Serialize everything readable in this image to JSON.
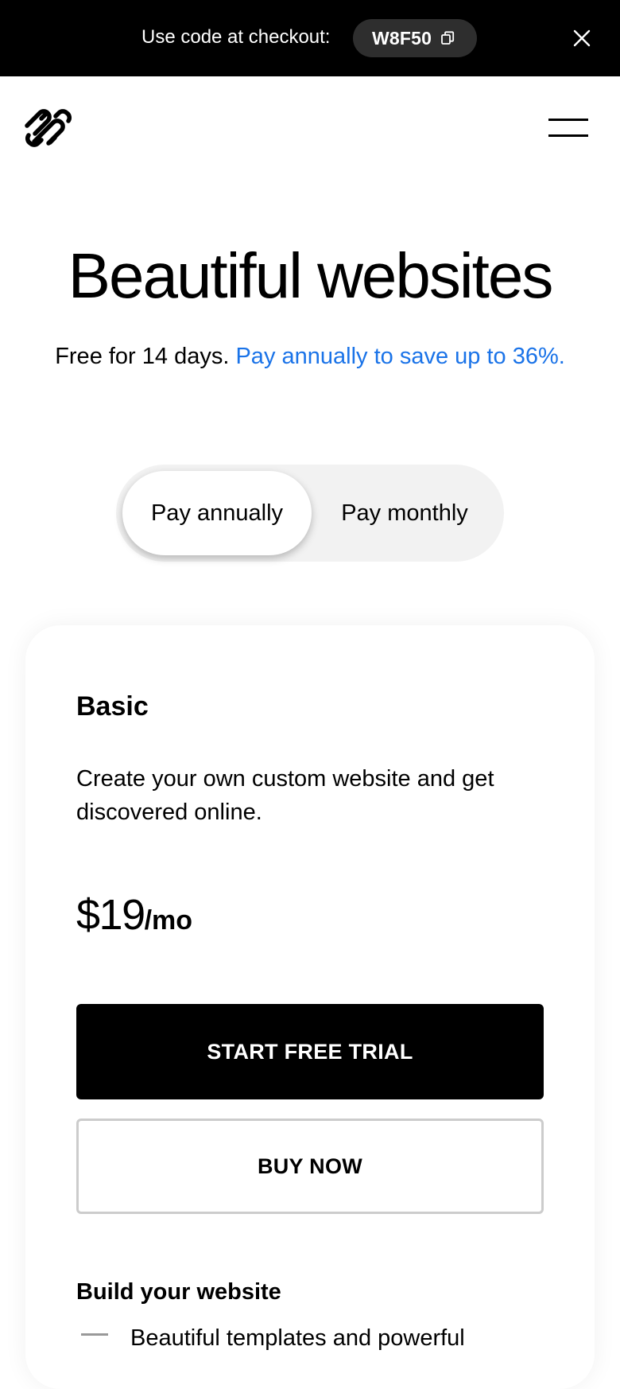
{
  "promo": {
    "text": "Use code at checkout:",
    "code": "W8F50",
    "copy_icon": "copy-icon",
    "close_icon": "close-icon"
  },
  "nav": {
    "logo": "squarespace-logo",
    "menu_icon": "hamburger-menu-icon"
  },
  "hero": {
    "title": "Beautiful websites",
    "subtitle_plain": "Free for 14 days.",
    "subtitle_link": "Pay annually to save up to 36%."
  },
  "billing_toggle": {
    "options": [
      "Pay annually",
      "Pay monthly"
    ],
    "selected": "Pay annually"
  },
  "plan": {
    "name": "Basic",
    "description": "Create your own custom website and get discovered online.",
    "price": "$19",
    "period": "/mo",
    "primary_button": "START FREE TRIAL",
    "secondary_button": "BUY NOW",
    "section_title": "Build your website",
    "first_feature": "Beautiful templates and powerful"
  },
  "colors": {
    "promo_bg": "#000000",
    "promo_code_bg": "#2e2e2e",
    "link": "#1a73e8",
    "toggle_bg": "#f2f2f2",
    "primary_button": "#000000",
    "secondary_border": "#cccccc"
  }
}
